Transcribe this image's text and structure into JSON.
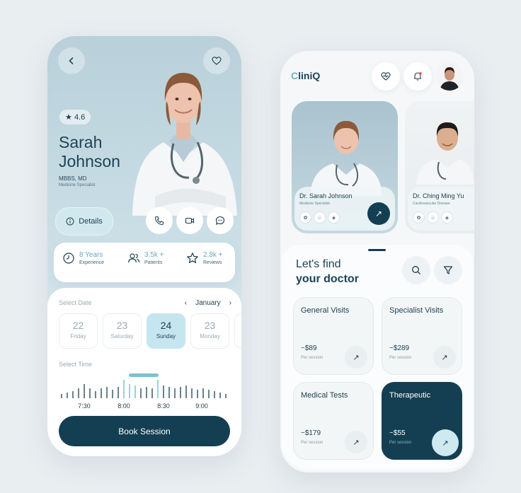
{
  "profile": {
    "rating": "4.6",
    "first_name": "Sarah",
    "last_name": "Johnson",
    "degree": "MBBS, MD",
    "specialty": "Medicine Specialist",
    "details_label": "Details",
    "stats": [
      {
        "value": "8 Years",
        "label": "Experience",
        "icon": "clock-icon"
      },
      {
        "value": "3.5k +",
        "label": "Patients",
        "icon": "users-icon"
      },
      {
        "value": "2.8k +",
        "label": "Reviews",
        "icon": "star-icon"
      }
    ],
    "select_date_label": "Select Date",
    "month": "January",
    "dates": [
      {
        "num": "22",
        "day": "Friday"
      },
      {
        "num": "23",
        "day": "Saturday"
      },
      {
        "num": "24",
        "day": "Sunday"
      },
      {
        "num": "23",
        "day": "Monday"
      }
    ],
    "selected_date_index": 2,
    "select_time_label": "Select Time",
    "times": [
      "7:30",
      "8:00",
      "8:30",
      "9:00"
    ],
    "book_label": "Book Session"
  },
  "home": {
    "logo_first": "C",
    "logo_rest": "liniQ",
    "doctors": [
      {
        "name": "Dr. Sarah Johnson",
        "specialty": "Medicine Specialist"
      },
      {
        "name": "Dr. Ching Ming Yu",
        "specialty": "Cardiovascular Disease"
      }
    ],
    "find_line1": "Let's find",
    "find_line2": "your doctor",
    "services": [
      {
        "title": "General Visits",
        "price": "~$89",
        "per": "Per session"
      },
      {
        "title": "Specialist Visits",
        "price": "~$289",
        "per": "Per session"
      },
      {
        "title": "Medical Tests",
        "price": "~$179",
        "per": "Per session"
      },
      {
        "title": "Therapeutic",
        "price": "~$55",
        "per": "Per session"
      }
    ]
  },
  "colors": {
    "primary_dark": "#143f52",
    "accent_light": "#c6e6ef",
    "accent_text": "#6ba8bb"
  }
}
